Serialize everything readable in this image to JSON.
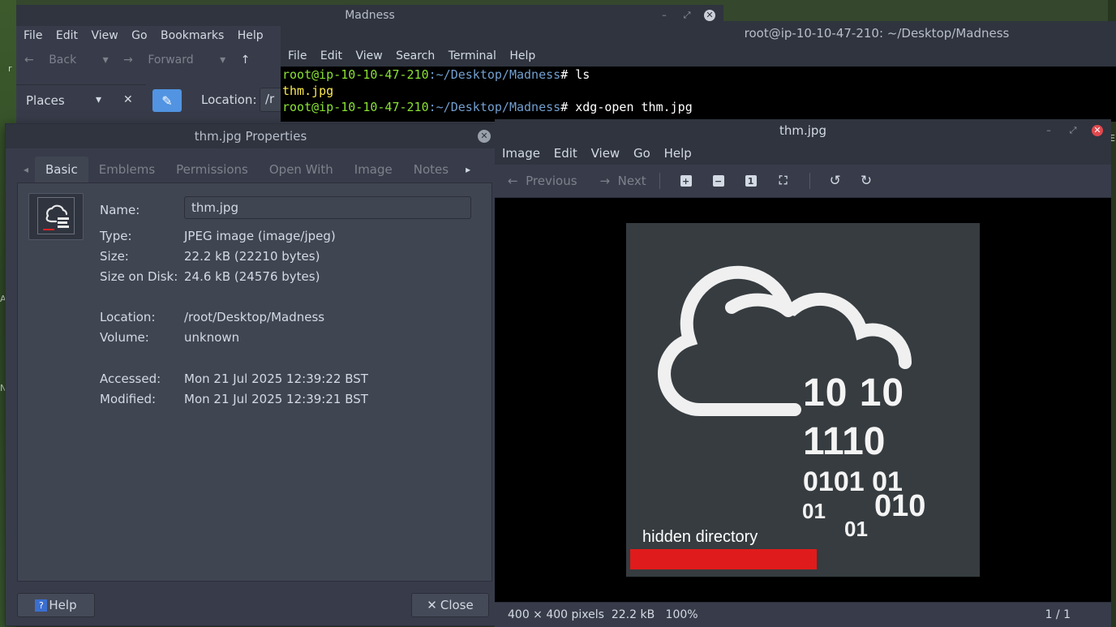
{
  "file_manager": {
    "title": "Madness",
    "menu": [
      "File",
      "Edit",
      "View",
      "Go",
      "Bookmarks",
      "Help"
    ],
    "back_label": "Back",
    "forward_label": "Forward",
    "places_label": "Places",
    "location_label": "Location:",
    "location_value": "/r"
  },
  "terminal": {
    "title": "root@ip-10-10-47-210: ~/Desktop/Madness",
    "menu": [
      "File",
      "Edit",
      "View",
      "Search",
      "Terminal",
      "Help"
    ],
    "lines": [
      {
        "user": "root@ip-10-10-47-210",
        "path": ":~/Desktop/Madness",
        "prompt": "#",
        "cmd": " ls"
      },
      {
        "output": "thm.jpg"
      },
      {
        "user": "root@ip-10-10-47-210",
        "path": ":~/Desktop/Madness",
        "prompt": "#",
        "cmd": " xdg-open thm.jpg"
      }
    ]
  },
  "properties": {
    "title": "thm.jpg Properties",
    "tabs": [
      "Basic",
      "Emblems",
      "Permissions",
      "Open With",
      "Image",
      "Notes"
    ],
    "active_tab": "Basic",
    "name_label": "Name:",
    "name_value": "thm.jpg",
    "type_label": "Type:",
    "type_value": "JPEG image (image/jpeg)",
    "size_label": "Size:",
    "size_value": "22.2 kB (22210 bytes)",
    "disk_label": "Size on Disk:",
    "disk_value": "24.6 kB (24576 bytes)",
    "location_label": "Location:",
    "location_value": "/root/Desktop/Madness",
    "volume_label": "Volume:",
    "volume_value": "unknown",
    "accessed_label": "Accessed:",
    "accessed_value": "Mon 21 Jul 2025 12:39:22 BST",
    "modified_label": "Modified:",
    "modified_value": "Mon 21 Jul 2025 12:39:21 BST",
    "help_label": "Help",
    "close_label": "Close"
  },
  "viewer": {
    "title": "thm.jpg",
    "menu": [
      "Image",
      "Edit",
      "View",
      "Go",
      "Help"
    ],
    "previous_label": "Previous",
    "next_label": "Next",
    "image_text": {
      "binary_rows": [
        "10 10",
        "1110",
        "0101 01",
        "01",
        "010",
        "01"
      ],
      "hidden_label": "hidden directory"
    },
    "status_left": "400 × 400 pixels  22.2 kB   100%",
    "status_right": "1 / 1"
  },
  "colors": {
    "accent": "#5294e2",
    "prompt_user": "#8ae234",
    "prompt_path": "#729fcf",
    "file_output": "#fce94f",
    "redaction": "#e01b1b",
    "close_red": "#e0494f"
  },
  "desktop": {
    "edge_letters": [
      "r",
      "A",
      "N",
      "E"
    ]
  }
}
